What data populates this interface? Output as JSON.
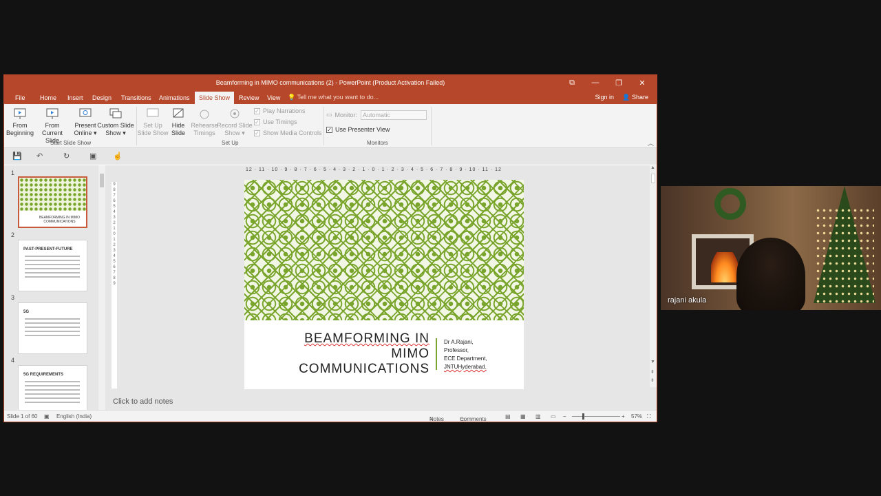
{
  "window": {
    "title": "Beamforming in MIMO communications (2) - PowerPoint (Product Activation Failed)"
  },
  "tabs": [
    "File",
    "Home",
    "Insert",
    "Design",
    "Transitions",
    "Animations",
    "Slide Show",
    "Review",
    "View"
  ],
  "active_tab": "Slide Show",
  "tell_me": "Tell me what you want to do...",
  "account": {
    "sign_in": "Sign in",
    "share": "Share"
  },
  "ribbon": {
    "start": {
      "from_beginning": [
        "From",
        "Beginning"
      ],
      "from_current": [
        "From",
        "Current Slide"
      ],
      "present_online": [
        "Present",
        "Online ▾"
      ],
      "custom_show": [
        "Custom Slide",
        "Show ▾"
      ],
      "label": "Start Slide Show"
    },
    "setup": {
      "set_up": [
        "Set Up",
        "Slide Show"
      ],
      "hide": [
        "Hide",
        "Slide"
      ],
      "rehearse": [
        "Rehearse",
        "Timings"
      ],
      "record": [
        "Record Slide",
        "Show ▾"
      ],
      "play_narrations": "Play Narrations",
      "use_timings": "Use Timings",
      "show_media": "Show Media Controls",
      "label": "Set Up"
    },
    "monitors": {
      "monitor_label": "Monitor:",
      "monitor_value": "Automatic",
      "presenter_view": "Use Presenter View",
      "label": "Monitors"
    }
  },
  "thumbnails": [
    {
      "num": "1",
      "title": "BEAMFORMING IN MIMO COMMUNICATIONS"
    },
    {
      "num": "2",
      "title": "PAST-PRESENT-FUTURE"
    },
    {
      "num": "3",
      "title": "5G"
    },
    {
      "num": "4",
      "title": "5G REQUIREMENTS"
    }
  ],
  "slide": {
    "title_line1": "BEAMFORMING IN",
    "title_line2": "MIMO",
    "title_line3": "COMMUNICATIONS",
    "author_line1": "Dr A.Rajani,",
    "author_line2": "Professor,",
    "author_line3": "ECE Department,",
    "author_line4": "JNTUHyderabad."
  },
  "hruler": "12 · 11 · 10 · 9 · 8 · 7 · 6 · 5 · 4 · 3 · 2 · 1 · 0 · 1 · 2 · 3 · 4 · 5 · 6 · 7 · 8 · 9 · 10 · 11 · 12",
  "notes_placeholder": "Click to add notes",
  "status": {
    "slide_info": "Slide 1 of 60",
    "language": "English (India)",
    "notes": "Notes",
    "comments": "Comments",
    "zoom": "57%"
  },
  "video": {
    "participant": "rajani akula"
  },
  "colors": {
    "accent": "#b7472a",
    "pattern_green": "#7aa52c"
  }
}
